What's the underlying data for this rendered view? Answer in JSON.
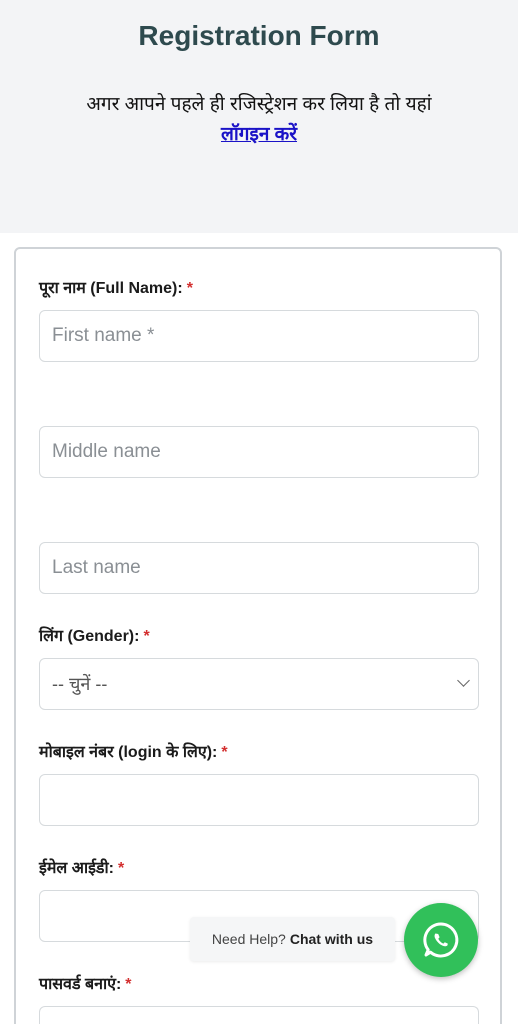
{
  "header": {
    "title": "Registration Form",
    "subtitle": "अगर आपने पहले ही रजिस्ट्रेशन कर लिया है तो यहां",
    "login_link": "लॉगइन करें"
  },
  "form": {
    "full_name_label": "पूरा नाम (Full Name):",
    "first_name_placeholder": "First name *",
    "middle_name_placeholder": "Middle name",
    "last_name_placeholder": "Last name",
    "gender_label": "लिंग (Gender):",
    "gender_selected": "-- चुनें --",
    "mobile_label": "मोबाइल नंबर (login के लिए):",
    "email_label": "ईमेल आईडी:",
    "password_label": "पासवर्ड बनाएं:",
    "required_mark": "*"
  },
  "chat": {
    "prefix": "Need Help?",
    "action": "Chat with us",
    "icon": "whatsapp-icon"
  },
  "colors": {
    "accent": "#31c05a",
    "required": "#d32f2f",
    "link": "#1a12c7",
    "title": "#2e4a4e"
  }
}
